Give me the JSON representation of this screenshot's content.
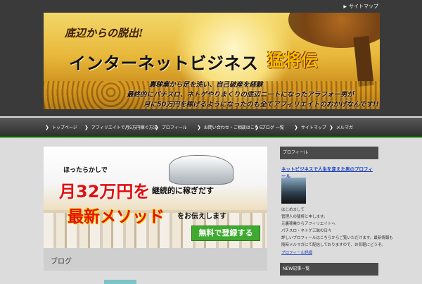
{
  "header": {
    "top_link": "サイトマップ",
    "banner": {
      "tagline": "底辺からの脱出!",
      "title": "インターネットビジネス",
      "title_accent": "猛将伝",
      "sub_lines": [
        "裏稼業から足を洗い、自己破産を経験",
        "最終的にパチスロ、ネトゲやりまくりの底辺ニートになったアラフォー男が",
        "月に50万円を稼げるようになったのも全てアフィリエイトのおかげなんです!!"
      ]
    }
  },
  "nav": {
    "items": [
      "トップページ",
      "アフィリエイトで月5万円稼ぐ方法",
      "プロフィール",
      "お問い合わせ・ご相談はこちら",
      "ブログ 一覧",
      "サイトマップ",
      "メルマガ"
    ]
  },
  "main": {
    "ad": {
      "line1": "ほったらかしで",
      "line2": "月32万円を",
      "line2b": "継続的に稼ぎだす",
      "line3": "最新メソッド",
      "line3b": "をお伝えします",
      "button": "無料で登録する"
    },
    "content_title": "ブログ"
  },
  "sidebar": {
    "widget1_title": "プロフィール",
    "widget1_link": "ネットビジネスで人生を変えた男のプロフィール",
    "profile_lines": [
      "はじめまして",
      "管理人の猛将と申します。",
      "元裏稼業からアフィリエイトへ",
      "パチスロ・ネトゲ三昧の日々",
      "詳しいプロフィールはこちらからご覧いただけます。最新情報も",
      "随時メルマガにて配信しておりますので、お気軽にどうぞ。"
    ],
    "more_link": "プロフィール詳細",
    "widget2_title": "NEW記事一覧"
  },
  "colors": {
    "nav_accent": "#4bbf3a",
    "link": "#1a3fbf",
    "ad_red": "#e01010"
  }
}
